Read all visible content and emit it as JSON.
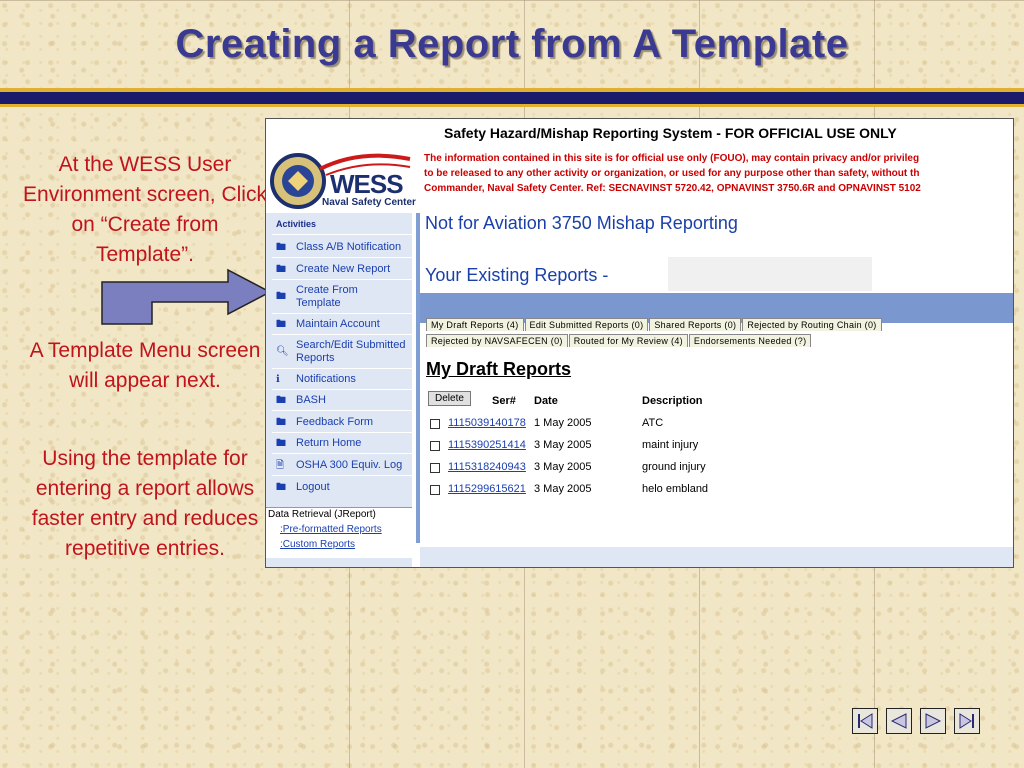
{
  "slide": {
    "title": "Creating a Report from A Template",
    "text1": "At the WESS User Environment screen, Click on “Create from Template”.",
    "text2": "A Template Menu screen will appear next.",
    "text3": "Using the template for entering a report allows faster entry and reduces repetitive entries."
  },
  "screen": {
    "header_title": "Safety Hazard/Mishap Reporting System - FOR OFFICIAL USE ONLY",
    "warning_lines": [
      "The information contained in this site is for official use only (FOUO), may contain privacy and/or privileg",
      "to be released to any other activity or organization, or used for any purpose other than safety, without th",
      "Commander, Naval Safety Center. Ref: SECNAVINST 5720.42, OPNAVINST 3750.6R and OPNAVINST 5102"
    ],
    "logo_text": "WESS",
    "logo_subtext": "Naval Safety Center",
    "sidebar": {
      "heading": "Activities",
      "items": [
        {
          "label": "Class A/B Notification",
          "icon": "folder-icon"
        },
        {
          "label": "Create New Report",
          "icon": "folder-icon"
        },
        {
          "label": "Create From Template",
          "icon": "folder-icon"
        },
        {
          "label": "Maintain Account",
          "icon": "folder-icon"
        },
        {
          "label": "Search/Edit Submitted Reports",
          "icon": "magnifier-icon"
        },
        {
          "label": "Notifications",
          "icon": "info-icon"
        },
        {
          "label": "BASH",
          "icon": "folder-icon"
        },
        {
          "label": "Feedback Form",
          "icon": "folder-icon"
        },
        {
          "label": "Return Home",
          "icon": "folder-icon"
        },
        {
          "label": "OSHA 300 Equiv. Log",
          "icon": "document-icon"
        },
        {
          "label": "Logout",
          "icon": "folder-icon"
        }
      ],
      "data_retrieval": {
        "title": "Data Retrieval (JReport)",
        "links": [
          ":Pre-formatted Reports",
          ":Custom Reports"
        ]
      }
    },
    "subtitle1": "Not for Aviation 3750 Mishap Reporting",
    "subtitle2": "Your Existing Reports -",
    "tabs_row1": [
      "My Draft Reports (4)",
      "Edit Submitted Reports (0)",
      "Shared Reports (0)",
      "Rejected by Routing Chain (0)"
    ],
    "tabs_row2": [
      "Rejected by NAVSAFECEN (0)",
      "Routed for My Review (4)",
      "Endorsements Needed (?)"
    ],
    "section_title": "My Draft Reports",
    "delete_label": "Delete",
    "columns": [
      "Ser#",
      "Date",
      "Description"
    ],
    "rows": [
      {
        "serial": "1115039140178",
        "date": "1 May 2005",
        "description": "ATC"
      },
      {
        "serial": "1115390251414",
        "date": "3 May 2005",
        "description": "maint injury"
      },
      {
        "serial": "1115318240943",
        "date": "3 May 2005",
        "description": "ground injury"
      },
      {
        "serial": "1115299615621",
        "date": "3 May 2005",
        "description": "helo embland"
      }
    ]
  },
  "nav_buttons": [
    "first-icon",
    "previous-icon",
    "next-icon",
    "last-icon"
  ],
  "colors": {
    "title": "#3b3a92",
    "body_text": "#c0141c",
    "link": "#1a3fb0",
    "warning": "#cc0000"
  }
}
